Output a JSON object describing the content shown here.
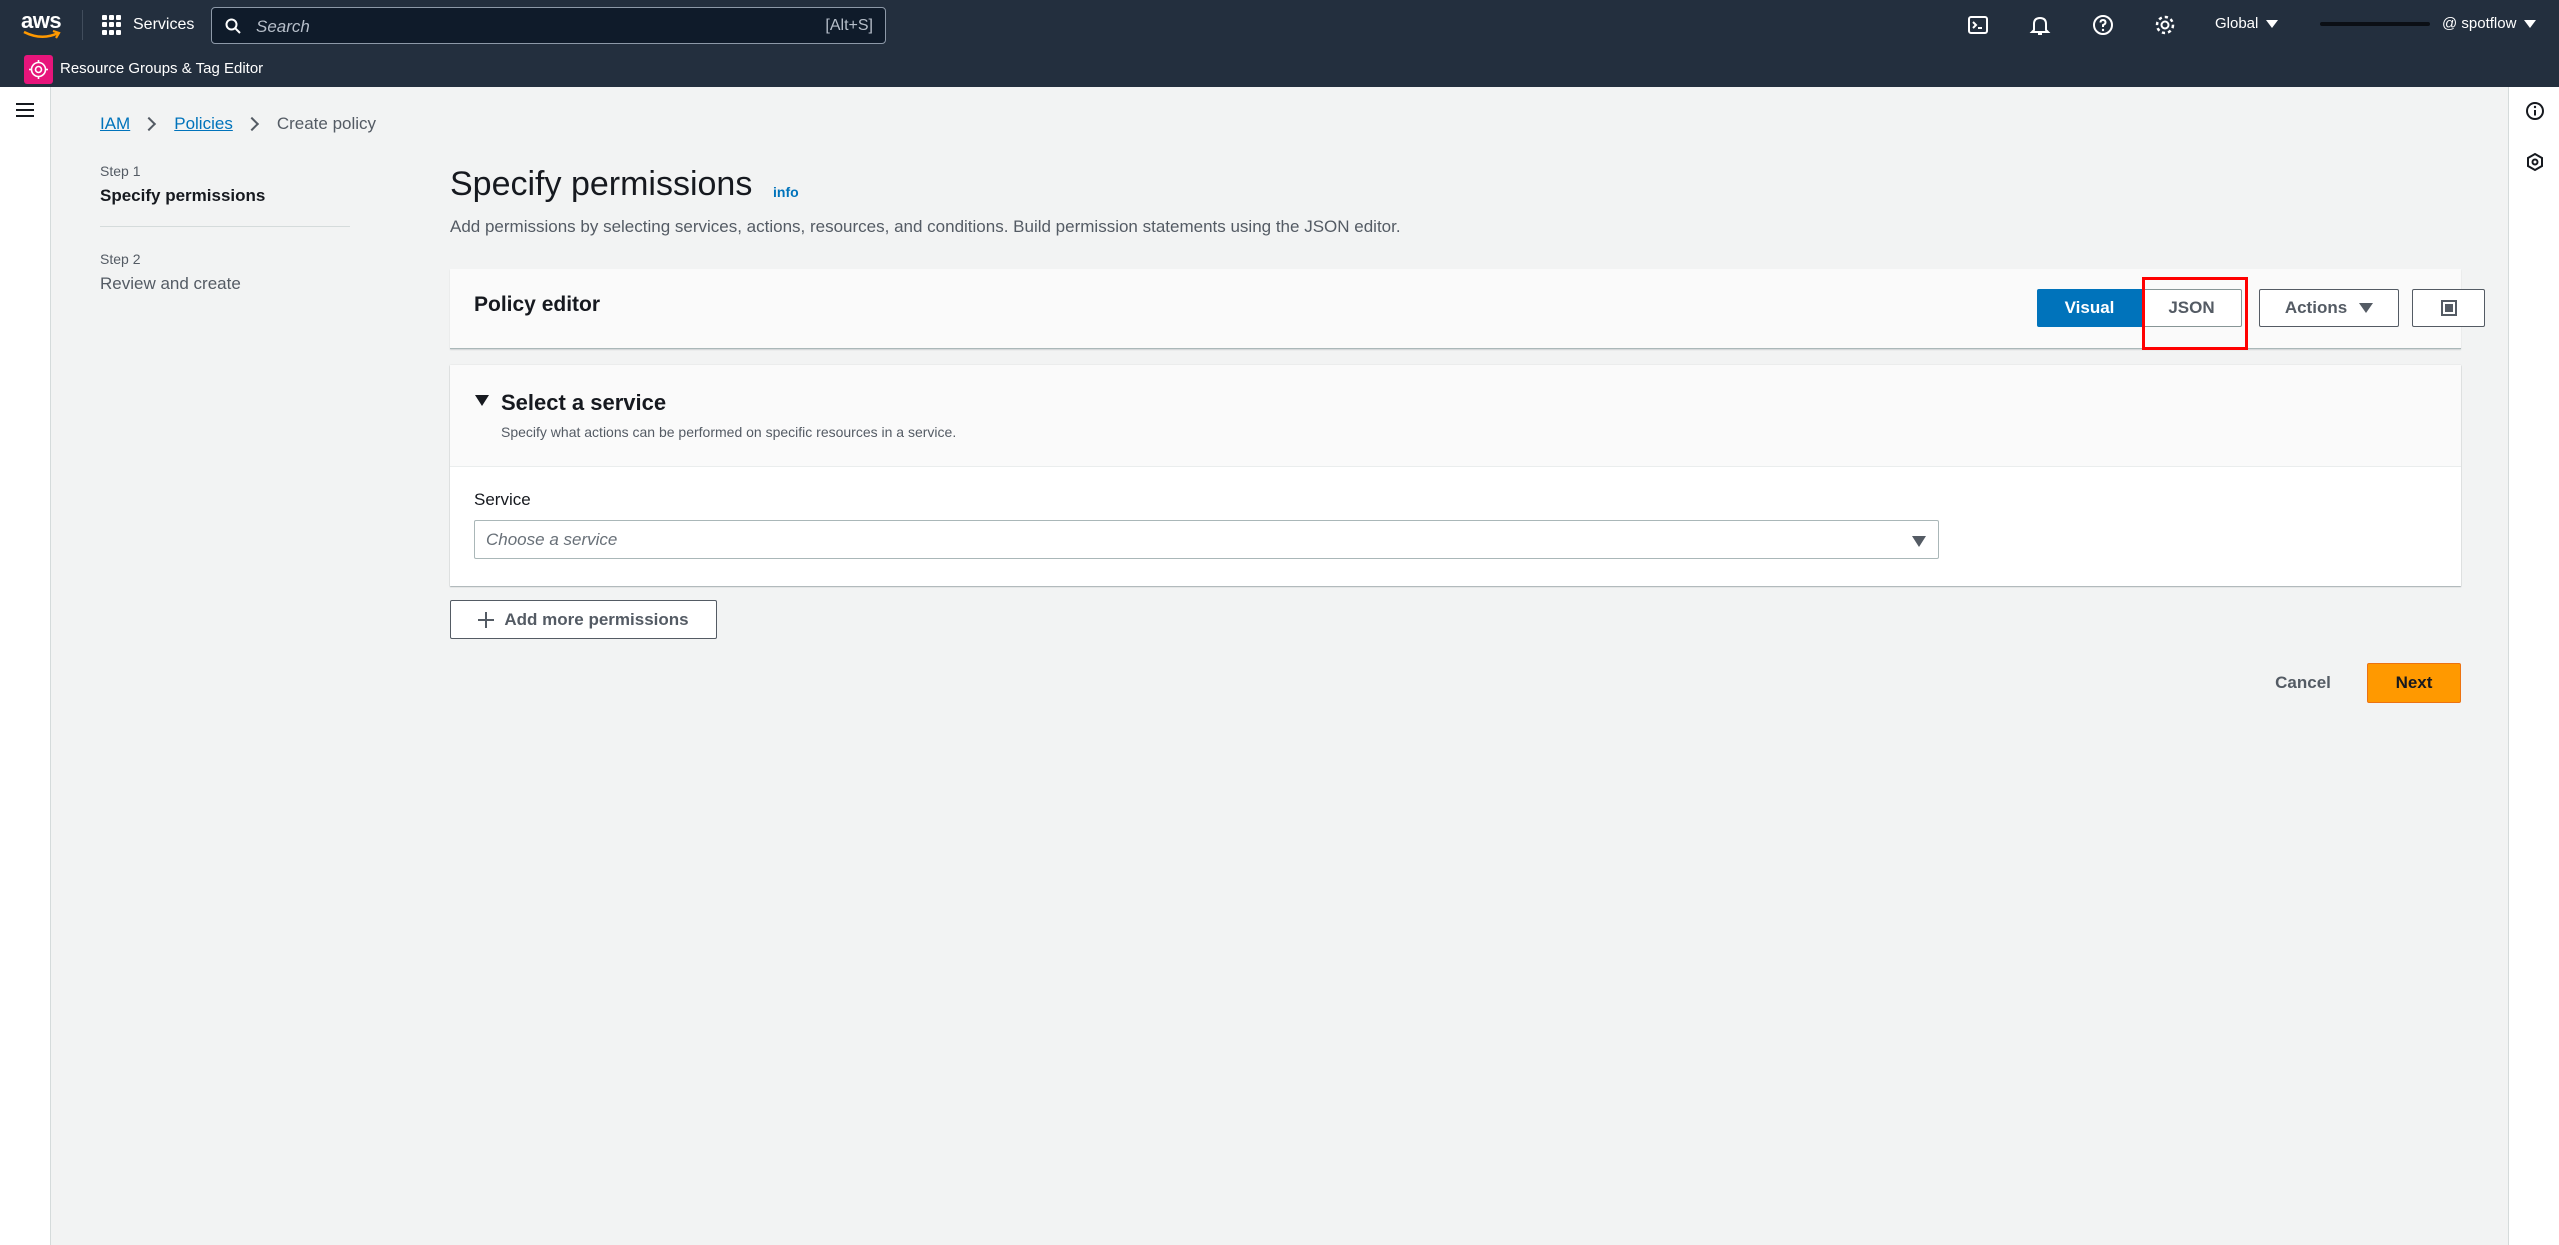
{
  "topnav": {
    "logo_text": "aws",
    "services_label": "Services",
    "search_placeholder": "Search",
    "search_shortcut": "[Alt+S]",
    "region": "Global",
    "account": "@ spotflow",
    "icons": [
      "cloudshell-icon",
      "bell-icon",
      "help-icon",
      "gear-icon"
    ]
  },
  "subnav": {
    "service_shortcut": "Resource Groups & Tag Editor",
    "service_color": "#e7157b"
  },
  "breadcrumb": {
    "items": [
      "IAM",
      "Policies",
      "Create policy"
    ]
  },
  "steps": [
    {
      "number": "Step 1",
      "title": "Specify permissions"
    },
    {
      "number": "Step 2",
      "title": "Review and create"
    }
  ],
  "page": {
    "title": "Specify permissions",
    "info": "info",
    "description": "Add permissions by selecting services, actions, resources, and conditions. Build permission statements using the JSON editor."
  },
  "editor": {
    "title": "Policy editor",
    "visual_label": "Visual",
    "json_label": "JSON",
    "actions_label": "Actions",
    "selected_mode": "Visual"
  },
  "service_section": {
    "title": "Select a service",
    "description": "Specify what actions can be performed on specific resources in a service.",
    "field_label": "Service",
    "placeholder": "Choose a service"
  },
  "buttons": {
    "add_more": "Add more permissions",
    "cancel": "Cancel",
    "next": "Next"
  },
  "colors": {
    "topbar": "#232f3e",
    "accent_blue": "#0073bb",
    "primary_orange": "#ff9900",
    "highlight_red": "#ff0000"
  }
}
